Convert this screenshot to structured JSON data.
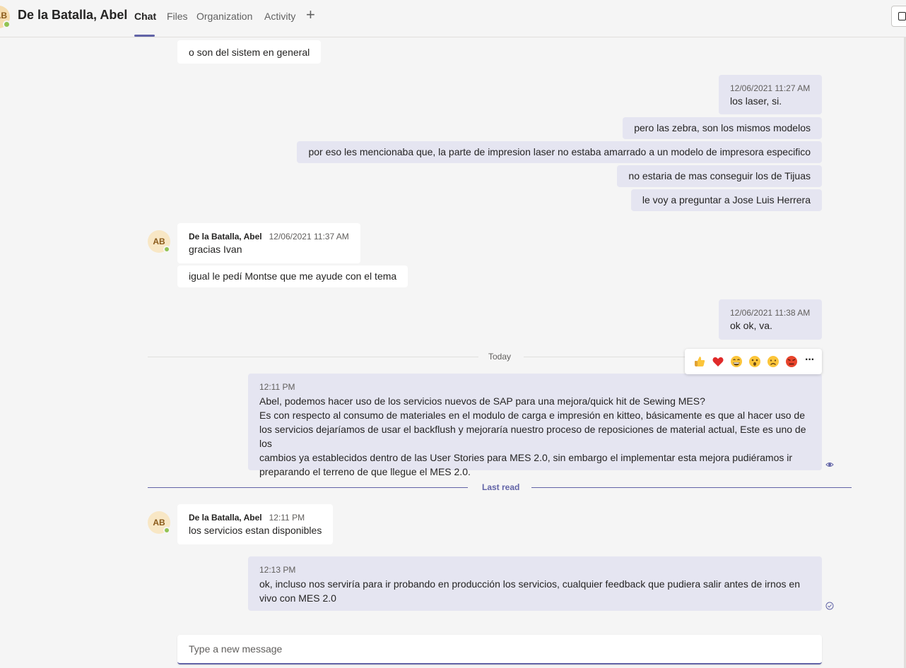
{
  "header": {
    "avatar_initials": "AB",
    "title": "De la Batalla, Abel",
    "tabs": [
      {
        "label": "Chat"
      },
      {
        "label": "Files"
      },
      {
        "label": "Organization"
      },
      {
        "label": "Activity"
      }
    ],
    "add_tab_icon": "plus-icon"
  },
  "messages": [
    {
      "text": "o son del sistem en general"
    },
    {
      "timestamp": "12/06/2021 11:27 AM",
      "text": "los laser, si."
    },
    {
      "text": "pero las zebra, son los mismos modelos"
    },
    {
      "text": "por eso les mencionaba que, la parte de impresion laser no estaba amarrado a un modelo de impresora especifico"
    },
    {
      "text": "no estaria de mas conseguir los de Tijuas"
    },
    {
      "text": "le voy a preguntar a Jose Luis Herrera"
    },
    {
      "sender": "De la Batalla, Abel",
      "timestamp": "12/06/2021 11:37 AM",
      "text": "gracias Ivan"
    },
    {
      "text": "igual le pedí Montse que me ayude con el tema"
    },
    {
      "timestamp": "12/06/2021 11:38 AM",
      "text": "ok ok, va."
    },
    {
      "timestamp": "12:11 PM",
      "lines": [
        "Abel, podemos hacer uso de los servicios nuevos de SAP para una mejora/quick hit de Sewing MES?",
        "Es con respecto al consumo de materiales en el modulo de carga e impresión en kitteo, básicamente es que al hacer uso de",
        "los servicios dejaríamos de usar el backflush y mejoraría nuestro proceso de reposiciones de material actual, Este es uno de los",
        "cambios ya establecidos dentro de las User Stories para MES 2.0, sin embargo el implementar esta mejora pudiéramos ir",
        "preparando el terreno de que llegue el MES 2.0."
      ]
    },
    {
      "sender": "De la Batalla, Abel",
      "timestamp": "12:11 PM",
      "text": "los servicios estan disponibles"
    },
    {
      "timestamp": "12:13 PM",
      "lines": [
        "ok, incluso nos serviría para ir probando en producción los servicios, cualquier feedback que pudiera salir antes de irnos en",
        "vivo con MES 2.0"
      ]
    }
  ],
  "avatars": {
    "initials": "AB"
  },
  "dividers": {
    "today": "Today",
    "last_read": "Last read"
  },
  "reactions": [
    "like-icon",
    "heart-icon",
    "laugh-icon",
    "surprised-icon",
    "sad-icon",
    "angry-icon",
    "more-options-icon"
  ],
  "reactions_more_glyph": "···",
  "composer": {
    "placeholder": "Type a new message"
  },
  "colors": {
    "accent": "#6264a7",
    "outgoing_bubble": "#e5e5f1",
    "incoming_bubble": "#ffffff",
    "background": "#f5f5f5",
    "presence": "#92c353"
  }
}
